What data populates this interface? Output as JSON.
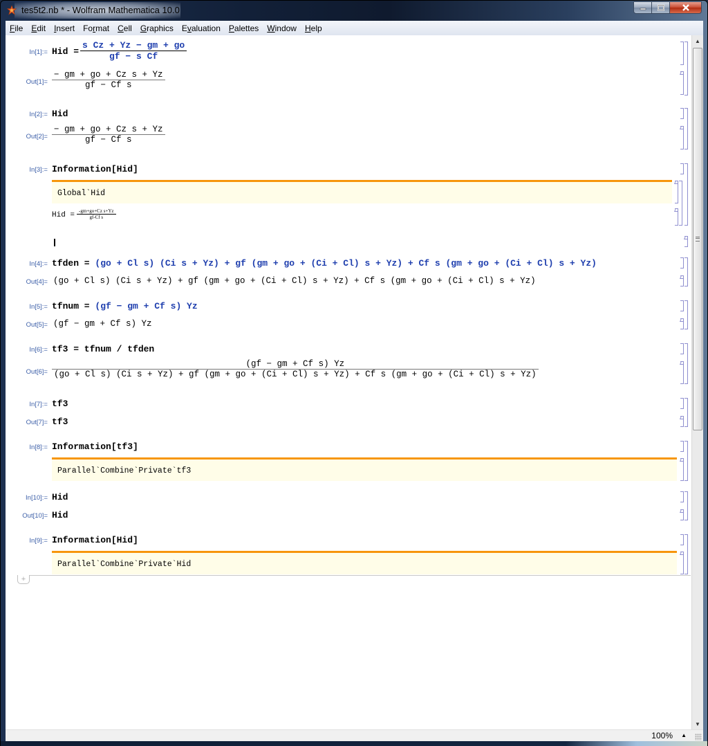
{
  "window": {
    "title": "tes5t2.nb * - Wolfram Mathematica 10.0",
    "app_icon": "mathematica-spikey-icon",
    "controls": [
      "minimize",
      "maximize",
      "close"
    ]
  },
  "menu": [
    {
      "label": "File",
      "accel": "F"
    },
    {
      "label": "Edit",
      "accel": "E"
    },
    {
      "label": "Insert",
      "accel": "I"
    },
    {
      "label": "Format",
      "accel": "r"
    },
    {
      "label": "Cell",
      "accel": "C"
    },
    {
      "label": "Graphics",
      "accel": "G"
    },
    {
      "label": "Evaluation",
      "accel": "v"
    },
    {
      "label": "Palettes",
      "accel": "P"
    },
    {
      "label": "Window",
      "accel": "W"
    },
    {
      "label": "Help",
      "accel": "H"
    }
  ],
  "cells": {
    "c1": {
      "in_label": "In[1]:=",
      "in_lhs": "Hid =",
      "in_num": "s Cz + Yz − gm + go",
      "in_den": "gf − s Cf",
      "out_label": "Out[1]=",
      "out_num": "− gm + go + Cz s + Yz",
      "out_den": "gf − Cf s"
    },
    "c2": {
      "in_label": "In[2]:=",
      "in_text": "Hid",
      "out_label": "Out[2]=",
      "out_num": "− gm + go + Cz s + Yz",
      "out_den": "gf − Cf s"
    },
    "c3": {
      "in_label": "In[3]:=",
      "in_text": "Information[Hid]",
      "info_symbol": "Global`Hid",
      "def_lhs": "Hid =",
      "def_num": "-gm+go+Cz s+Yz",
      "def_den": "gf-Cf s"
    },
    "c4": {
      "in_label": "In[4]:=",
      "in_lhs": "tfden =",
      "in_rhs": "(go + Cl s) (Ci s + Yz) + gf (gm + go + (Ci + Cl) s + Yz) + Cf s (gm + go + (Ci + Cl) s + Yz)",
      "out_label": "Out[4]=",
      "out_text": "(go + Cl s) (Ci s + Yz) + gf (gm + go + (Ci + Cl) s + Yz) + Cf s (gm + go + (Ci + Cl) s + Yz)"
    },
    "c5": {
      "in_label": "In[5]:=",
      "in_lhs": "tfnum =",
      "in_rhs": "(gf − gm + Cf s) Yz",
      "out_label": "Out[5]=",
      "out_text": "(gf − gm + Cf s) Yz"
    },
    "c6": {
      "in_label": "In[6]:=",
      "in_text": "tf3 = tfnum / tfden",
      "out_label": "Out[6]=",
      "out_num": "(gf − gm + Cf s) Yz",
      "out_den": "(go + Cl s) (Ci s + Yz) + gf (gm + go + (Ci + Cl) s + Yz) + Cf s (gm + go + (Ci + Cl) s + Yz)"
    },
    "c7": {
      "in_label": "In[7]:=",
      "in_text": "tf3",
      "out_label": "Out[7]=",
      "out_text": "tf3"
    },
    "c8": {
      "in_label": "In[8]:=",
      "in_text": "Information[tf3]",
      "info_symbol": "Parallel`Combine`Private`tf3"
    },
    "c10": {
      "in_label": "In[10]:=",
      "in_text": "Hid",
      "out_label": "Out[10]=",
      "out_text": "Hid"
    },
    "c9": {
      "in_label": "In[9]:=",
      "in_text": "Information[Hid]",
      "info_symbol": "Parallel`Combine`Private`Hid"
    }
  },
  "status": {
    "zoom": "100%"
  },
  "colors": {
    "input_blue": "#1f3fae",
    "label_blue": "#3c5fa8",
    "info_orange": "#f7960c",
    "info_bg": "#fffde8",
    "bracket": "#8e8ecf"
  }
}
